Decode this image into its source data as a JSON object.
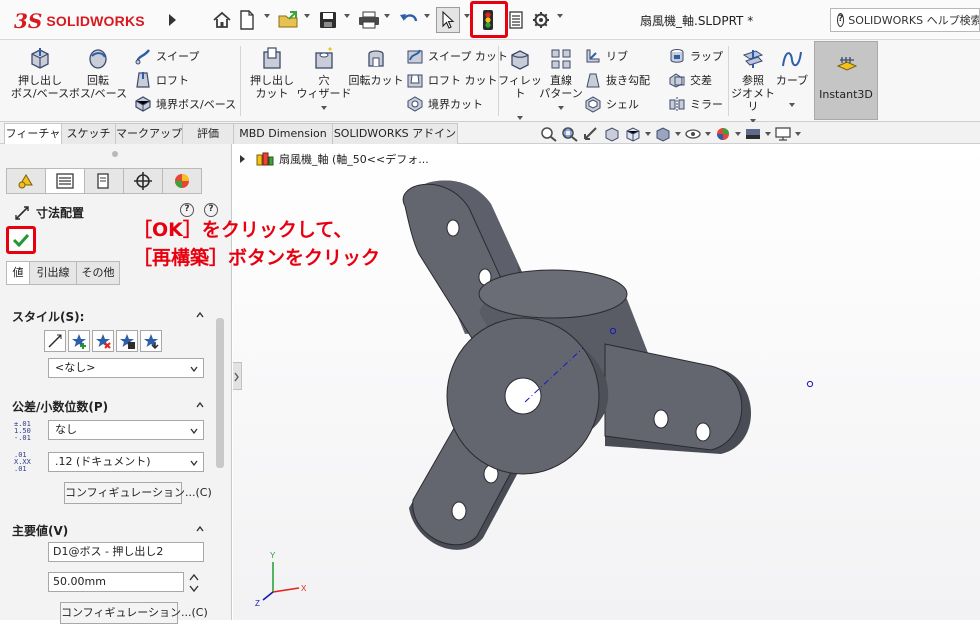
{
  "app": {
    "logo_mark": "3S",
    "logo_text": "SOLIDWORKS",
    "document_title": "扇風機_軸.SLDPRT *",
    "help_search": "SOLIDWORKS ヘルプ検索"
  },
  "ribbon": {
    "extrude_boss": "押し出し\nボス/ベース",
    "revolve_boss": "回転\nボス/ベース",
    "sweep": "スイープ",
    "loft": "ロフト",
    "boundary_boss": "境界ボス/ベース",
    "extrude_cut": "押し出し\nカット",
    "hole_wizard": "穴\nウィザード",
    "revolve_cut": "回転カット",
    "swept_cut": "スイープ カット",
    "lofted_cut": "ロフト カット",
    "boundary_cut": "境界カット",
    "fillet": "フィレット",
    "linear_pattern": "直線\nパターン",
    "rib": "リブ",
    "draft": "抜き勾配",
    "shell": "シェル",
    "wrap": "ラップ",
    "intersect": "交差",
    "mirror": "ミラー",
    "ref_geometry": "参照\nジオメトリ",
    "curves": "カーブ",
    "instant3d": "Instant3D"
  },
  "tabs": [
    {
      "label": "フィーチャー"
    },
    {
      "label": "スケッチ"
    },
    {
      "label": "マークアップ"
    },
    {
      "label": "評価"
    },
    {
      "label": "MBD Dimension"
    },
    {
      "label": "SOLIDWORKS アドイン"
    }
  ],
  "tree": {
    "root_label": "扇風機_軸 (軸_50<<デフォ..."
  },
  "property_manager": {
    "title": "寸法配置",
    "value_tabs": [
      "値",
      "引出線",
      "その他"
    ],
    "style_section": "スタイル(S):",
    "style_select": "<なし>",
    "tolerance_section": "公差/小数位数(P)",
    "tolerance_icon_text": "±.01\n1.50\n-.01",
    "precision_icon_text": ".01\nX.XX\n.01",
    "tolerance_type": "なし",
    "precision": ".12 (ドキュメント)",
    "config_button_1": "コンフィギュレーション...(C)",
    "primary_value_section": "主要値(V)",
    "dimension_name": "D1@ボス - 押し出し2",
    "dimension_value": "50.00mm",
    "config_button_2": "コンフィギュレーション...(C)"
  },
  "instruction": {
    "line1": "［OK］をクリックして、",
    "line2": "［再構築］ボタンをクリック"
  },
  "triad": {
    "x": "X",
    "y": "Y",
    "z": "Z"
  },
  "colors": {
    "accent_red": "#e8000f",
    "brand_red": "#d71920",
    "ok_green": "#1f9a2e",
    "model_gray": "#5d5f6a"
  }
}
